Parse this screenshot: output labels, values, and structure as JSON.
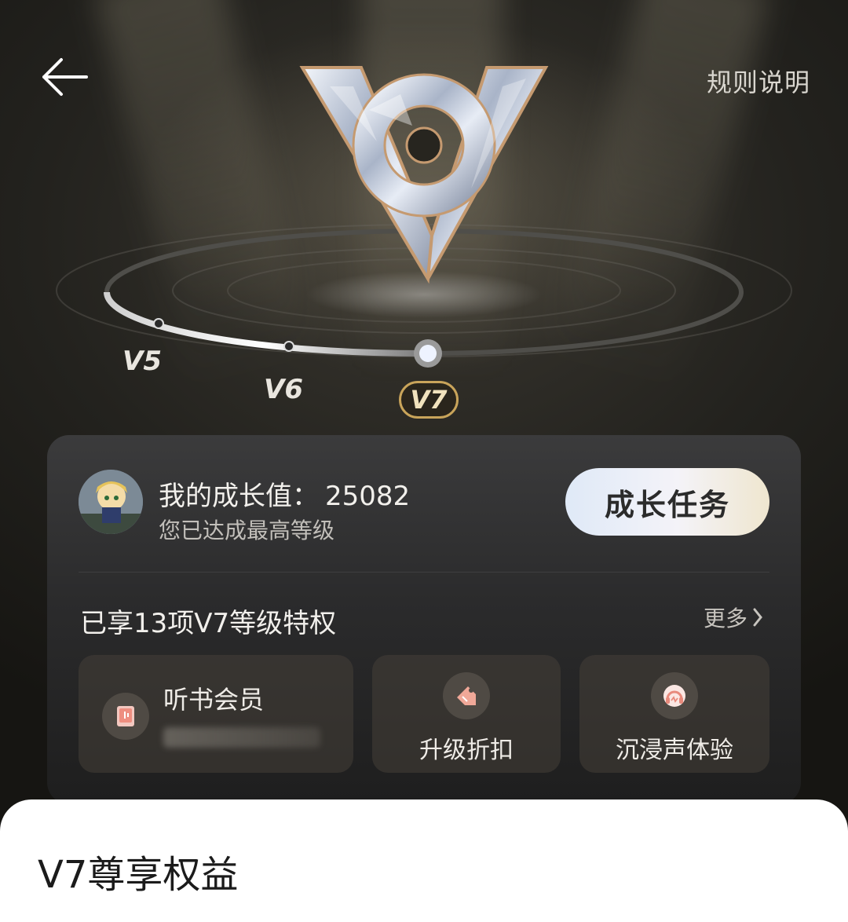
{
  "header": {
    "rules_label": "规则说明"
  },
  "levels": {
    "labels": [
      "V5",
      "V6"
    ],
    "current": "V7"
  },
  "growth": {
    "title": "我的成长值：",
    "value": "25082",
    "subtitle": "您已达成最高等级",
    "task_button": "成长任务"
  },
  "privileges": {
    "title": "已享13项V7等级特权",
    "more": "更多",
    "items": [
      {
        "name": "听书会员",
        "icon": "audiobook-icon"
      },
      {
        "name": "升级折扣",
        "icon": "price-tag-icon"
      },
      {
        "name": "沉浸声体验",
        "icon": "headphones-icon"
      }
    ]
  },
  "sheet": {
    "title": "V7尊享权益"
  },
  "colors": {
    "accent_gold": "#c9a45a",
    "tag_icon": "#e9a08e",
    "headphone_icon": "#e88a7c"
  }
}
